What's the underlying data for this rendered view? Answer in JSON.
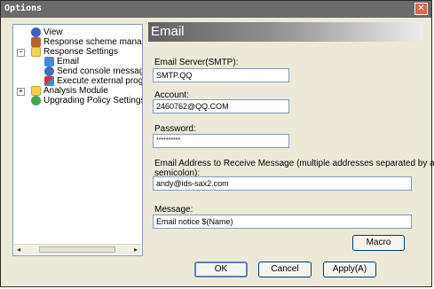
{
  "window": {
    "title": "Options",
    "close_glyph": "✕"
  },
  "tree": {
    "items": [
      {
        "label": "View",
        "icon": "gear-icon",
        "color": "#3b5fc4"
      },
      {
        "label": "Response scheme manager",
        "icon": "bag-icon",
        "color": "#b5642b"
      },
      {
        "label": "Response Settings",
        "icon": "folder-icon",
        "color": "#f5d05a",
        "expander": "−"
      },
      {
        "label": "Email",
        "icon": "mail-icon",
        "color": "#4a8ad4"
      },
      {
        "label": "Send console message",
        "icon": "info-icon",
        "color": "#3d6fbf"
      },
      {
        "label": "Execute external program",
        "icon": "program-icon",
        "color": "#c43b2f"
      },
      {
        "label": "Analysis Module",
        "icon": "folder-icon",
        "color": "#f5d05a",
        "expander": "+"
      },
      {
        "label": "Upgrading Policy Settings",
        "icon": "globe-icon",
        "color": "#3ba84a"
      }
    ],
    "scroll_left": "◂",
    "scroll_right": "▸"
  },
  "panel": {
    "title": "Email",
    "smtp_label": "Email Server(SMTP):",
    "smtp_value": "SMTP.QQ",
    "account_label": "Account:",
    "account_value": "2460762@QQ.COM",
    "password_label": "Password:",
    "password_value": "**********",
    "receive_label_line1": "Email Address to Receive Message (multiple addresses separated by a",
    "receive_label_line2": "semicolon):",
    "receive_value": "andy@ids-sax2.com",
    "message_label": "Message:",
    "message_value": "Email notice $(Name)",
    "macro_button": "Macro"
  },
  "footer": {
    "ok": "OK",
    "cancel": "Cancel",
    "apply": "Apply(A)"
  }
}
